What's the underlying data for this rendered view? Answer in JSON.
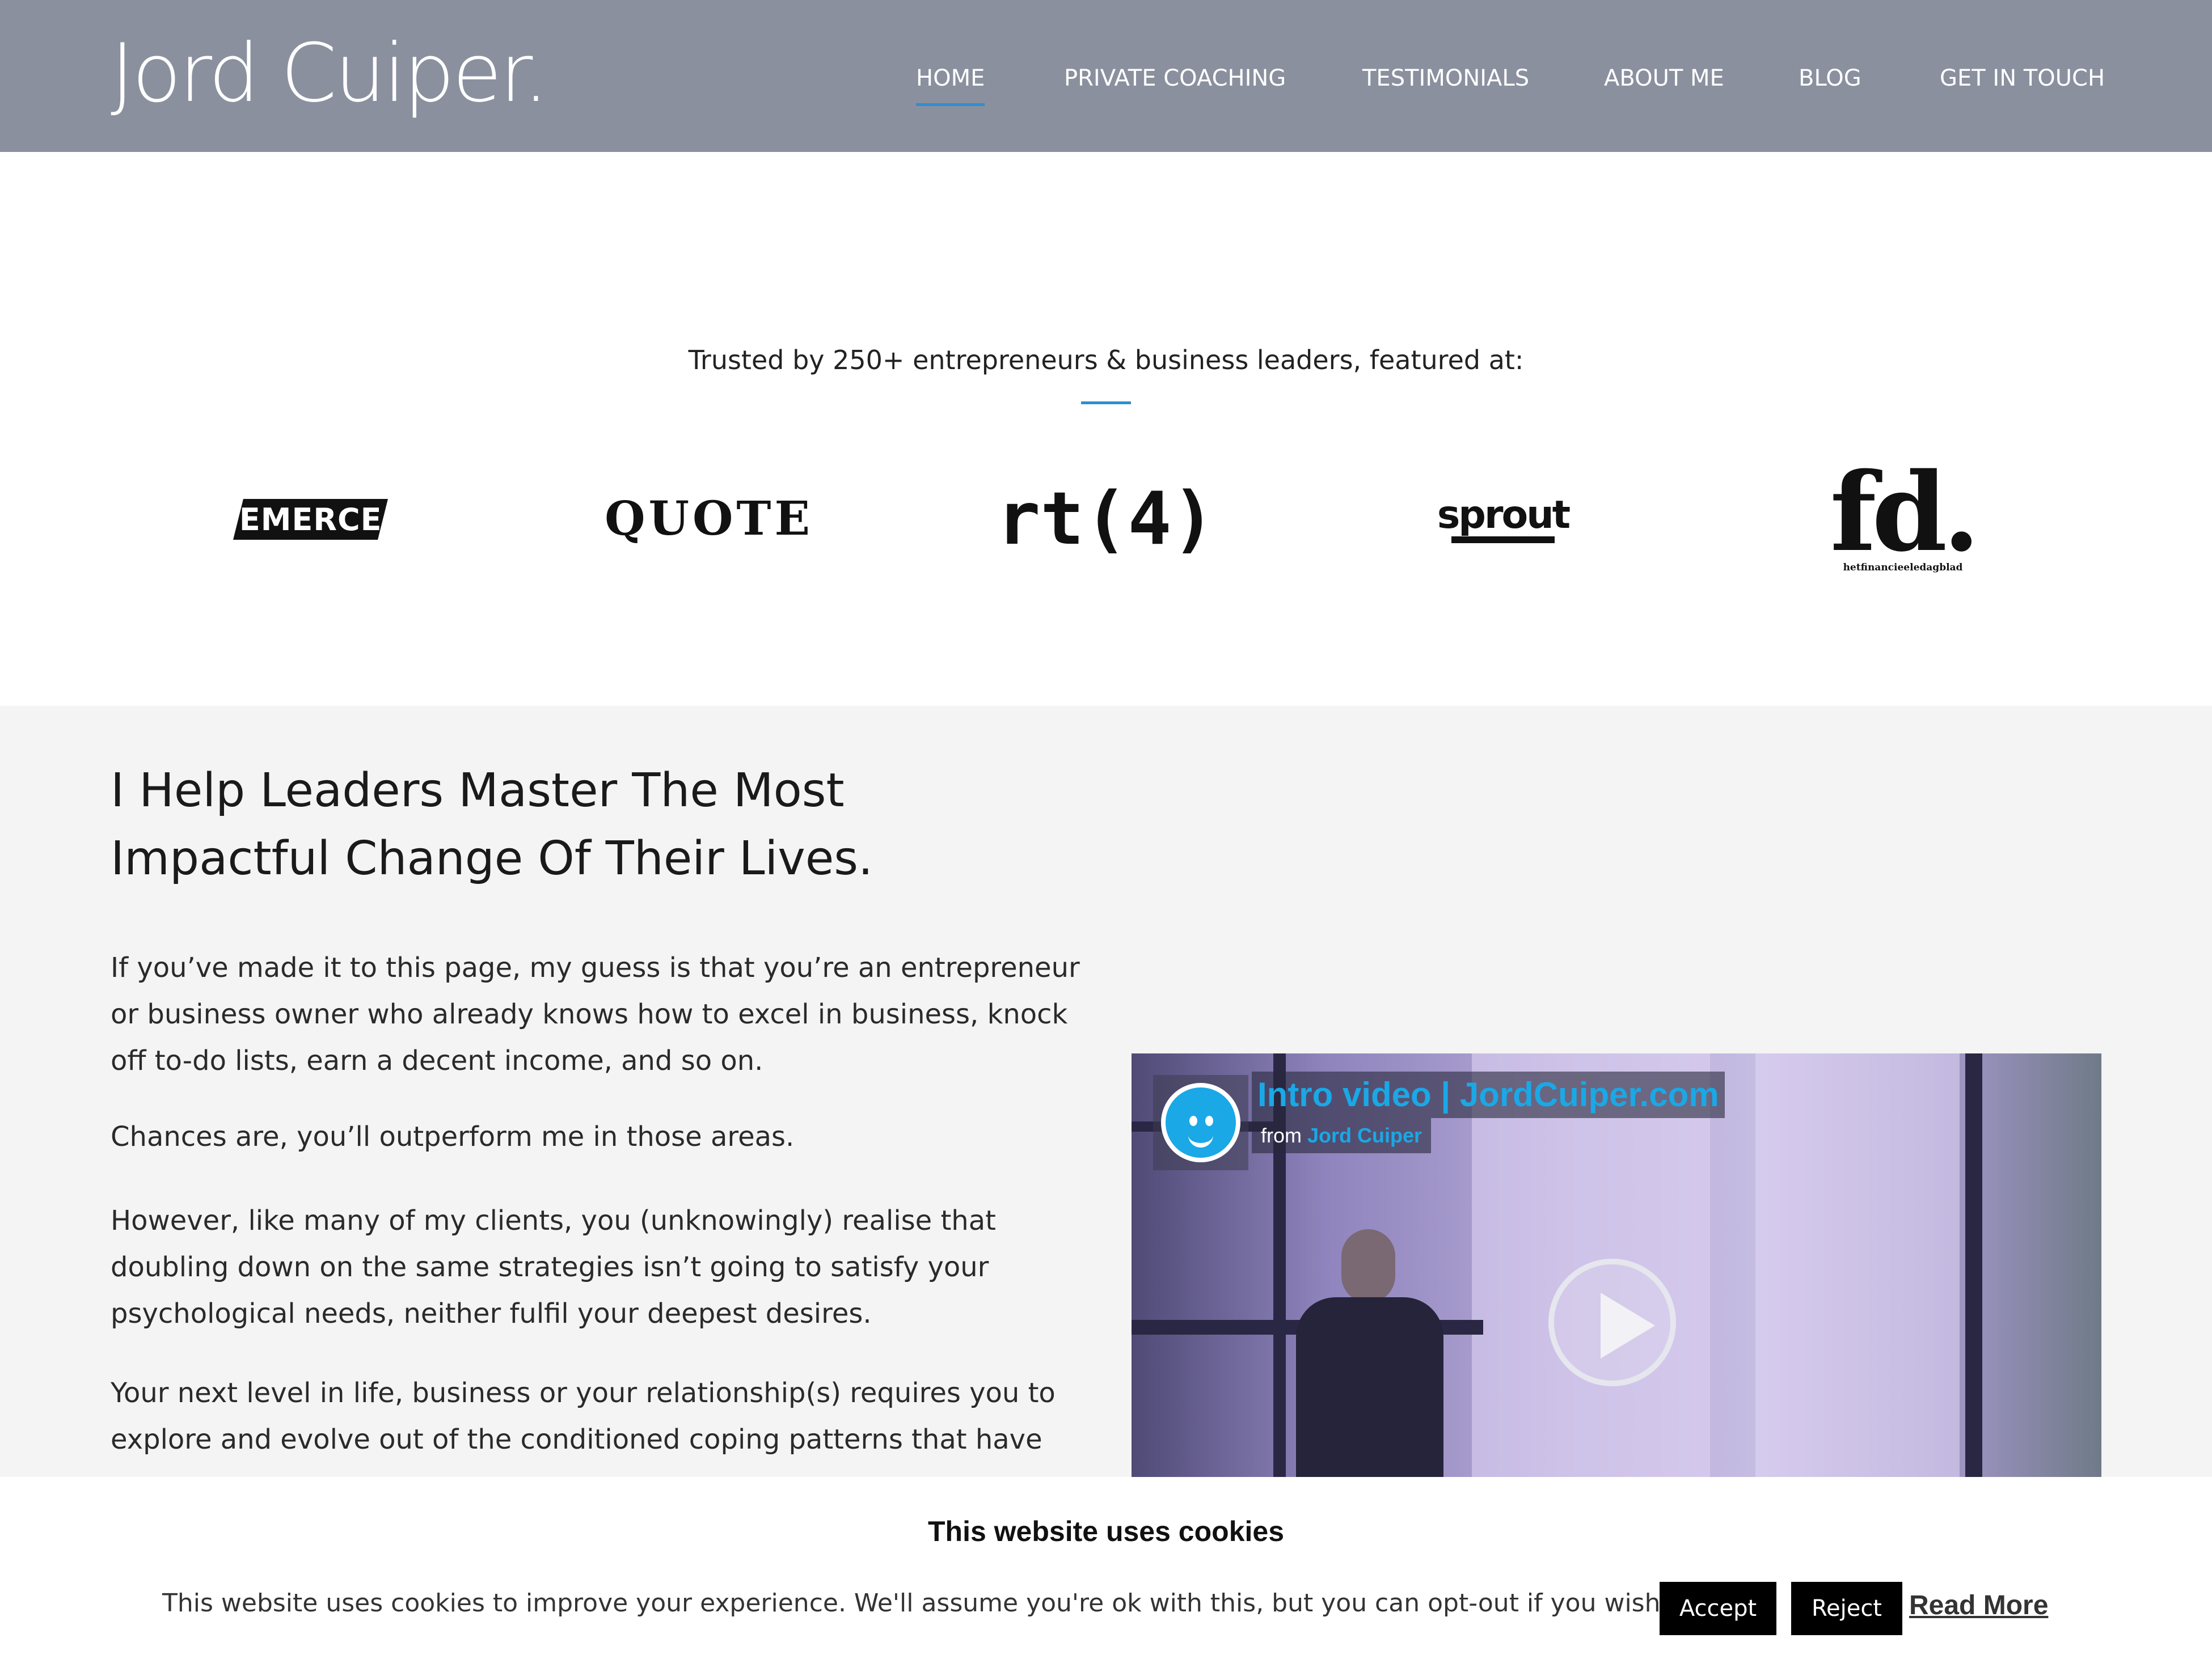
{
  "header": {
    "logo": "Jord Cuiper.",
    "nav": [
      "HOME",
      "PRIVATE COACHING",
      "TESTIMONIALS",
      "ABOUT ME",
      "BLOG",
      "GET IN TOUCH"
    ],
    "active_nav": "HOME"
  },
  "trusted": {
    "text": "Trusted by 250+ entrepreneurs & business leaders, featured at:",
    "logos": {
      "emerce": "EMERCE",
      "quote": "QUOTE",
      "rt4": "rt(4)",
      "sprout": "sprout",
      "fd": "fd.",
      "fd_tagline": "hetfinancieeledagblad"
    }
  },
  "main": {
    "headline": "I Help Leaders Master The Most Impactful Change Of Their Lives.",
    "paragraphs": [
      "If you’ve made it to this page, my guess is that you’re an entrepreneur or business owner who already knows how to excel in business, knock off to-do lists, earn a decent income, and so on.",
      "Chances are, you’ll outperform me in those areas.",
      "However, like many of my clients, you (unknowingly) realise that doubling down on the same strategies isn’t going to satisfy your psychological needs, neither fulfil your deepest desires.",
      "Your next level in life, business or your relationship(s) requires you to explore and evolve out of the conditioned coping patterns that have"
    ]
  },
  "video": {
    "title": "Intro video | JordCuiper.com",
    "from_label": "from",
    "author": "Jord Cuiper"
  },
  "cookie": {
    "title": "This website uses cookies",
    "text": "This website uses cookies to improve your experience. We'll assume you're ok with this, but you can opt-out if you wish.",
    "accept": "Accept",
    "reject": "Reject",
    "read_more": "Read More"
  },
  "colors": {
    "header_bg": "#8b909f",
    "accent": "#2e8fce",
    "section_bg": "#f4f4f4",
    "video_brand": "#1aa8e6"
  }
}
